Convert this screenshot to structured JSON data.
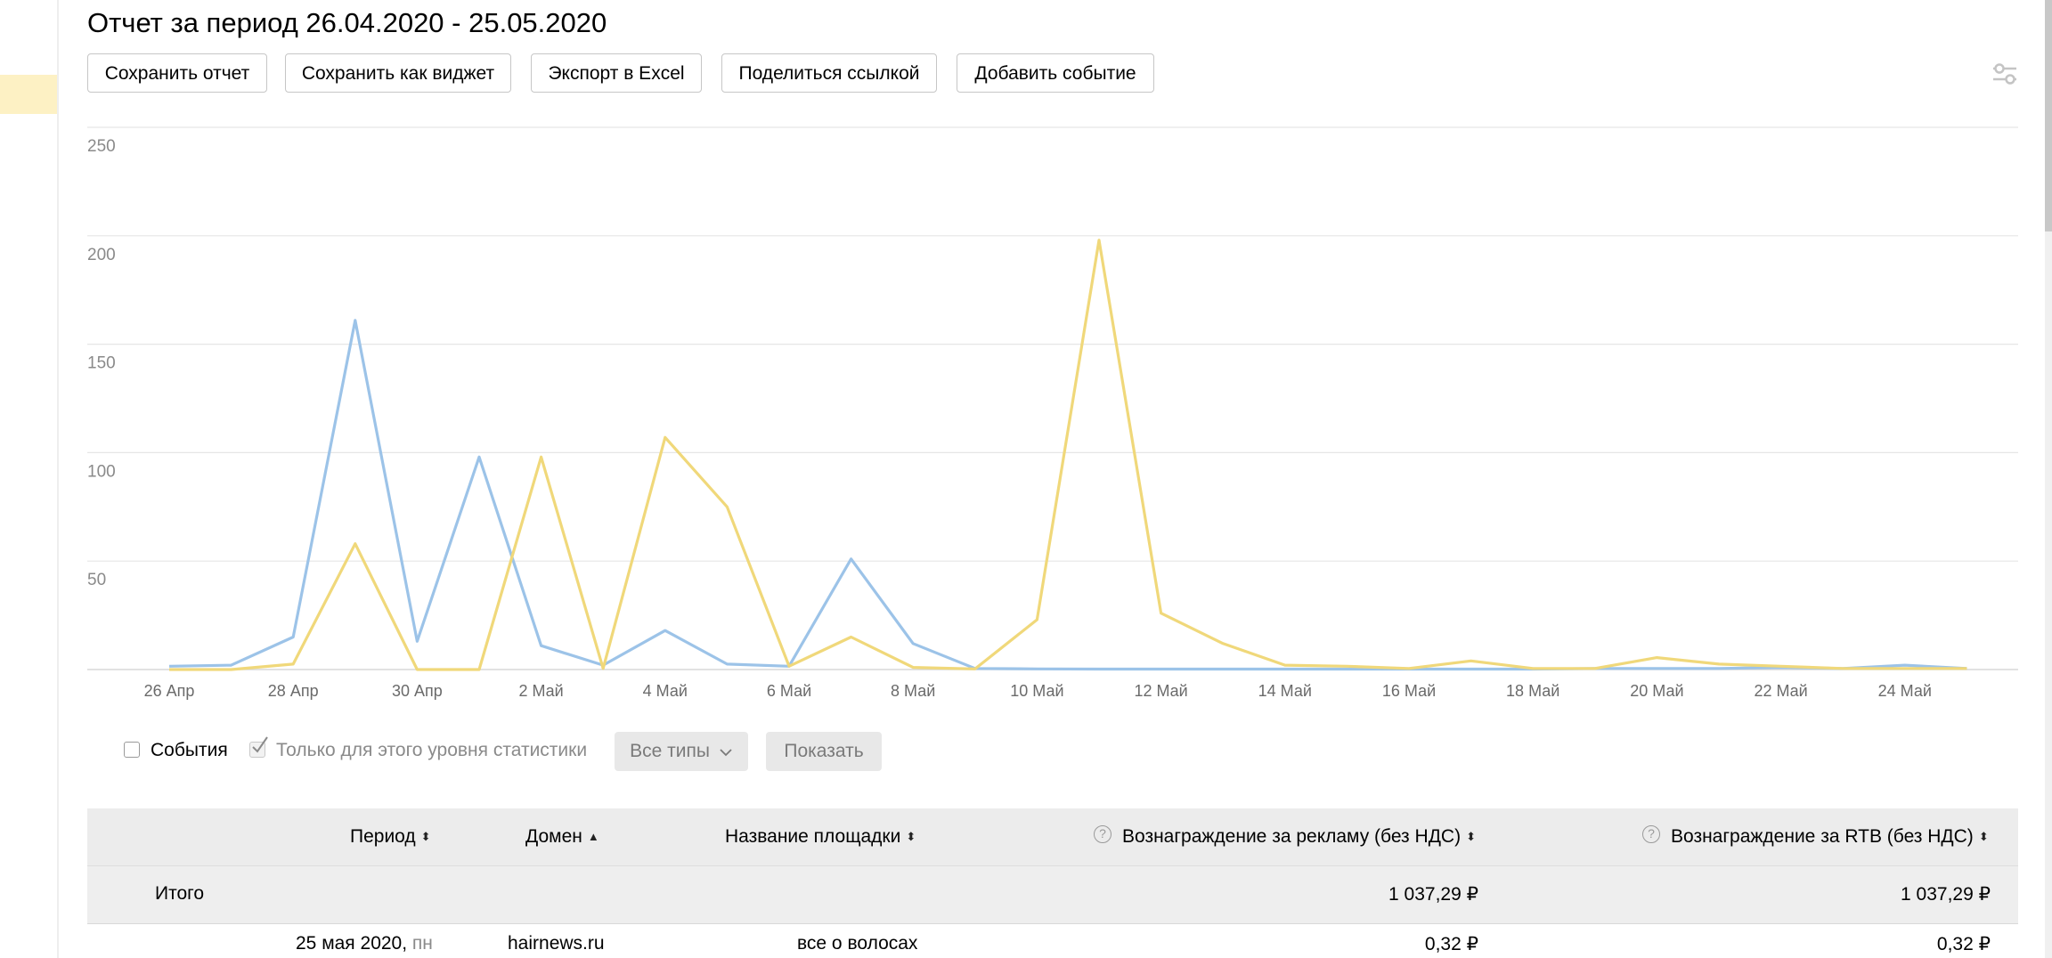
{
  "page_title": "Отчет за период 26.04.2020 - 25.05.2020",
  "toolbar": {
    "save_report": "Сохранить отчет",
    "save_widget": "Сохранить как виджет",
    "export_excel": "Экспорт в Excel",
    "share_link": "Поделиться ссылкой",
    "add_event": "Добавить событие"
  },
  "settings_icon": "sliders-icon",
  "chart_data": {
    "type": "line",
    "y_ticks": [
      50,
      100,
      150,
      200,
      250
    ],
    "ylim": [
      0,
      250
    ],
    "x_tick_labels": [
      "26 Апр",
      "28 Апр",
      "30 Апр",
      "2 Май",
      "4 Май",
      "6 Май",
      "8 Май",
      "10 Май",
      "12 Май",
      "14 Май",
      "16 Май",
      "18 Май",
      "20 Май",
      "22 Май",
      "24 Май"
    ],
    "categories": [
      "26 Апр",
      "27 Апр",
      "28 Апр",
      "29 Апр",
      "30 Апр",
      "1 Май",
      "2 Май",
      "3 Май",
      "4 Май",
      "5 Май",
      "6 Май",
      "7 Май",
      "8 Май",
      "9 Май",
      "10 Май",
      "11 Май",
      "12 Май",
      "13 Май",
      "14 Май",
      "15 Май",
      "16 Май",
      "17 Май",
      "18 Май",
      "19 Май",
      "20 Май",
      "21 Май",
      "22 Май",
      "23 Май",
      "24 Май",
      "25 Май"
    ],
    "series": [
      {
        "color": "#9cc3e8",
        "values": [
          1.5,
          2,
          15,
          161,
          13,
          98,
          11,
          2,
          18,
          2.5,
          1.5,
          51,
          12,
          0.5,
          0.3,
          0.2,
          0.2,
          0.2,
          0.2,
          0.2,
          0.2,
          0.2,
          0.2,
          0.5,
          0.5,
          0.5,
          1,
          0.5,
          2,
          0.5
        ]
      },
      {
        "color": "#f0d87a",
        "values": [
          0,
          0,
          2.5,
          58,
          0,
          0,
          98,
          0.5,
          107,
          75,
          1.5,
          15,
          1,
          0.3,
          23,
          198,
          26,
          12,
          2,
          1.5,
          0.5,
          4,
          0.5,
          0.5,
          5.5,
          2.5,
          1.5,
          0.5,
          0.5,
          0.5
        ]
      }
    ],
    "grid": true
  },
  "controls": {
    "events_label": "События",
    "events_checked": false,
    "level_only_label": "Только для этого уровня статистики",
    "level_only_checked": true,
    "types_select": "Все типы",
    "show_button": "Показать"
  },
  "table": {
    "columns": {
      "period": "Период",
      "domain": "Домен",
      "site_name": "Название площадки",
      "ad_reward": "Вознаграждение за рекламу (без НДС)",
      "rtb_reward": "Вознаграждение за RTB (без НДС)"
    },
    "total": {
      "label": "Итого",
      "ad_reward": "1 037,29 ₽",
      "rtb_reward": "1 037,29 ₽"
    },
    "rows": [
      {
        "date": "25 мая 2020,",
        "weekday": "пн",
        "domain": "hairnews.ru",
        "site_name": "все о волосах",
        "ad_reward": "0,32 ₽",
        "rtb_reward": "0,32 ₽"
      }
    ]
  }
}
